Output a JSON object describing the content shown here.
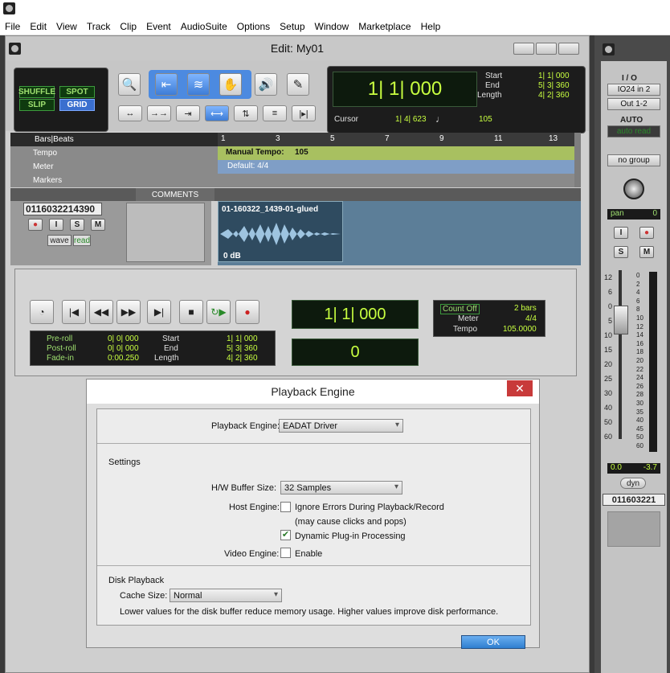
{
  "menu": [
    "File",
    "Edit",
    "View",
    "Track",
    "Clip",
    "Event",
    "AudioSuite",
    "Options",
    "Setup",
    "Window",
    "Marketplace",
    "Help"
  ],
  "edit_window": {
    "title": "Edit: My01",
    "modes": {
      "shuffle": "SHUFFLE",
      "spot": "SPOT",
      "slip": "SLIP",
      "grid": "GRID"
    },
    "main_counter": "1| 1| 000",
    "start_label": "Start",
    "end_label": "End",
    "length_label": "Length",
    "start": "1| 1| 000",
    "end": "5| 3| 360",
    "length": "4| 2| 360",
    "cursor_label": "Cursor",
    "cursor_value": "1| 4| 623",
    "grid_value": "105"
  },
  "rulers": {
    "timebase": "Bars|Beats",
    "bars": [
      "1",
      "3",
      "5",
      "7",
      "9",
      "11",
      "13"
    ],
    "rows": [
      {
        "label": "Tempo",
        "content": "Manual Tempo:",
        "value": "105"
      },
      {
        "label": "Meter",
        "content": "Default: 4/4"
      },
      {
        "label": "Markers",
        "content": ""
      }
    ],
    "comments_header": "COMMENTS"
  },
  "track": {
    "name": "0116032214390",
    "buttons": {
      "rec": "",
      "input": "I",
      "solo": "S",
      "mute": "M"
    },
    "view": "wave",
    "automation": "read",
    "clip_name": "01-160322_1439-01-glued",
    "clip_gain": "0 dB"
  },
  "transport": {
    "preroll_label": "Pre-roll",
    "postroll_label": "Post-roll",
    "fadein_label": "Fade-in",
    "preroll": "0| 0| 000",
    "postroll": "0| 0| 000",
    "fadein": "0:00.250",
    "start_label": "Start",
    "end_label": "End",
    "length_label": "Length",
    "start": "1| 1| 000",
    "end": "5| 3| 360",
    "length": "4| 2| 360",
    "main_counter": "1| 1| 000",
    "sub_counter": "0",
    "countoff_label": "Count Off",
    "countoff_value": "2 bars",
    "meter_label": "Meter",
    "meter_value": "4/4",
    "tempo_label": "Tempo",
    "tempo_value": "105.0000"
  },
  "dialog": {
    "title": "Playback Engine",
    "engine_label": "Playback Engine:",
    "engine_value": "EADAT Driver",
    "settings_heading": "Settings",
    "buffer_label": "H/W Buffer Size:",
    "buffer_value": "32 Samples",
    "host_label": "Host Engine:",
    "ignore_errors": "Ignore Errors During Playback/Record",
    "ignore_note": "(may cause clicks and pops)",
    "dynamic_plugin": "Dynamic Plug-in Processing",
    "video_label": "Video Engine:",
    "video_enable": "Enable",
    "disk_heading": "Disk Playback",
    "cache_label": "Cache Size:",
    "cache_value": "Normal",
    "cache_note": "Lower values for the disk buffer reduce memory usage.  Higher values improve disk performance.",
    "ok": "OK"
  },
  "mix_strip": {
    "io_label": "I / O",
    "input": "IO24 in 2",
    "output": "Out 1-2",
    "auto_label": "AUTO",
    "auto_mode": "auto read",
    "group": "no group",
    "pan_label": "pan",
    "pan_value": "0",
    "fader_scale": [
      "12",
      "6",
      "0",
      "5",
      "10",
      "15",
      "20",
      "25",
      "30",
      "40",
      "50",
      "60"
    ],
    "meter_scale": [
      "0",
      "2",
      "4",
      "6",
      "8",
      "10",
      "12",
      "14",
      "16",
      "18",
      "20",
      "22",
      "24",
      "26",
      "28",
      "30",
      "35",
      "40",
      "45",
      "50",
      "60"
    ],
    "level": "0.0",
    "peak": "-3.7",
    "dyn": "dyn",
    "name": "011603221",
    "buttons": {
      "input": "I",
      "rec": "",
      "solo": "S",
      "mute": "M"
    }
  }
}
